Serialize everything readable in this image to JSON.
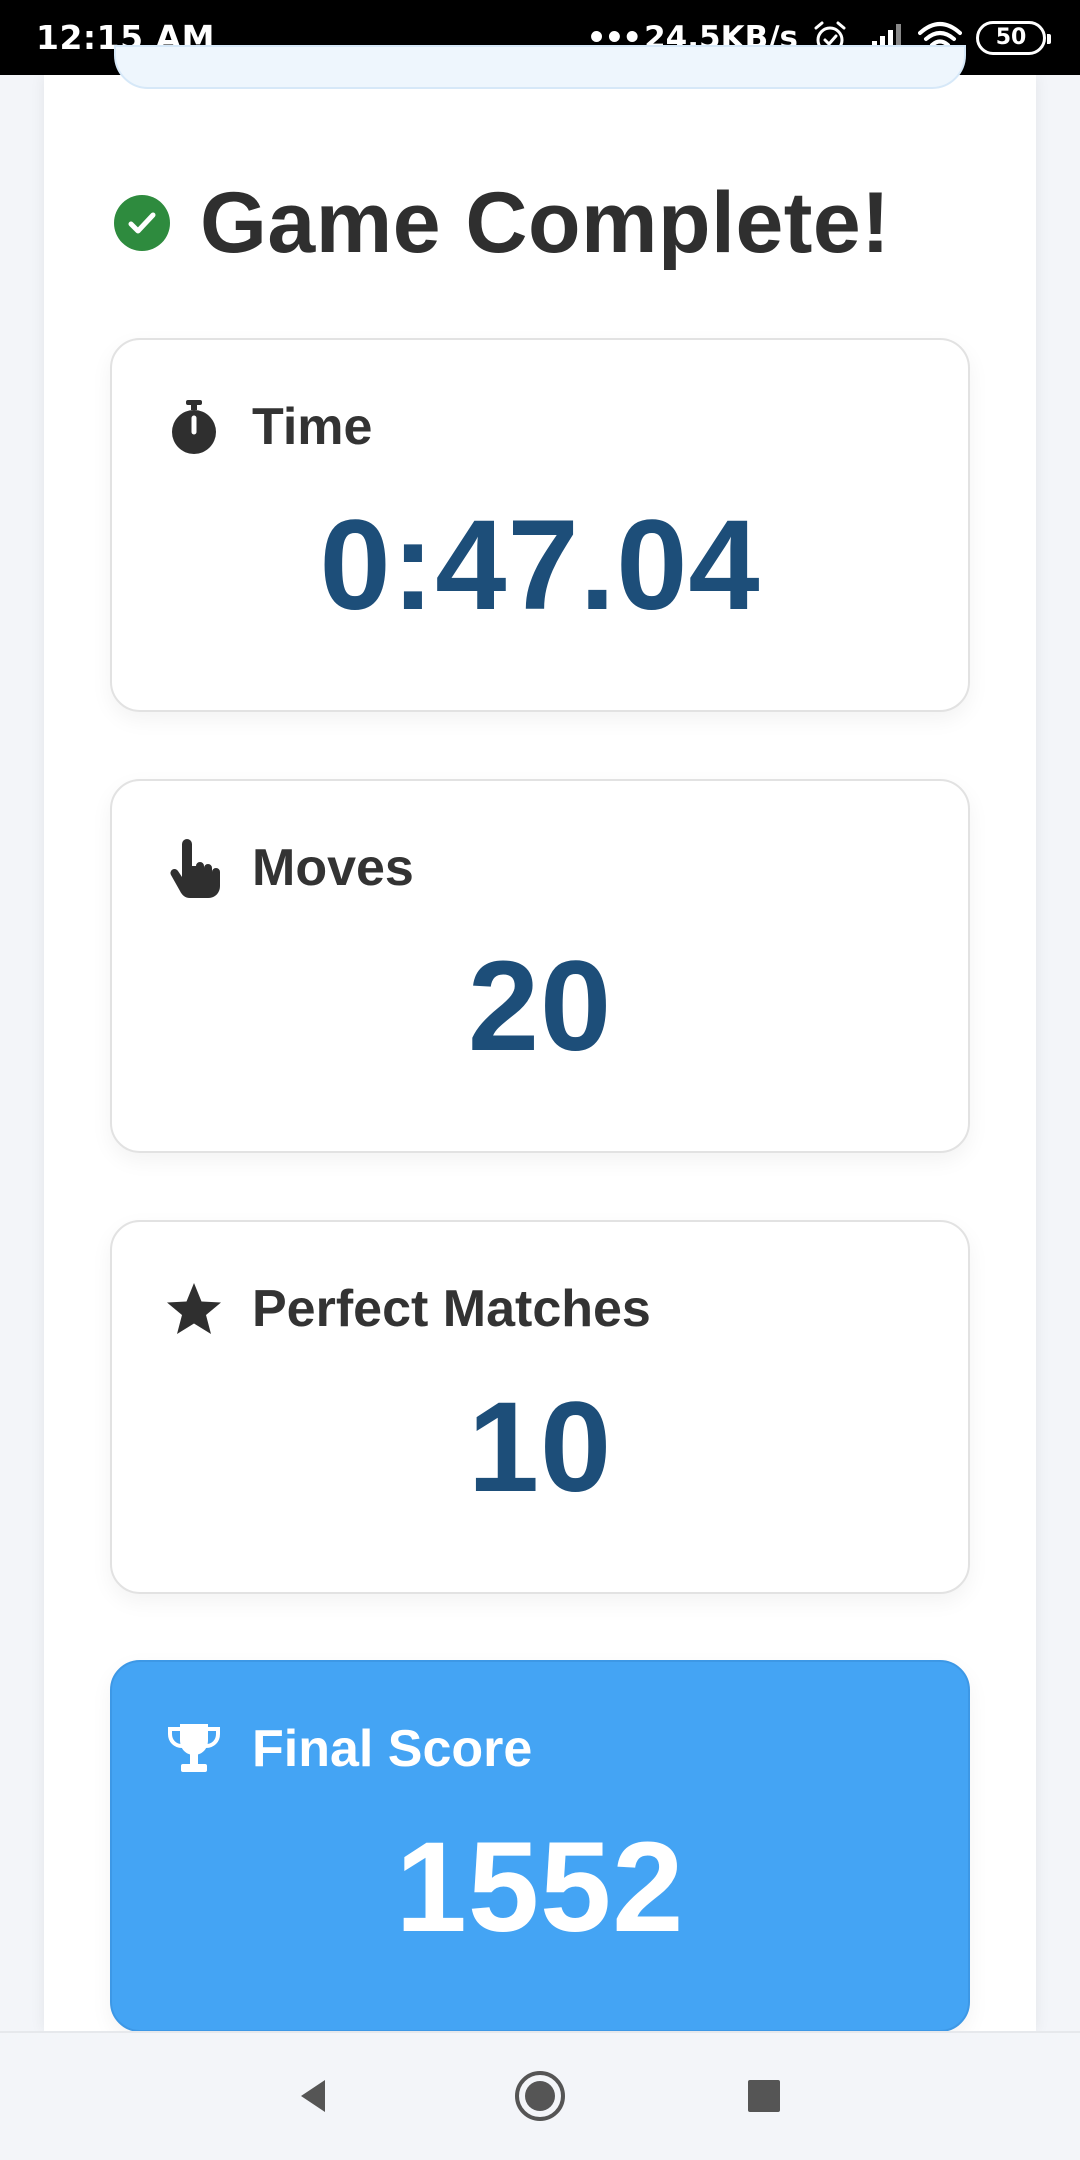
{
  "status_bar": {
    "time": "12:15 AM",
    "net_dots": "•••",
    "net_speed": "24.5KB/s",
    "battery_level": "50",
    "icons": [
      "alarm-icon",
      "signal-icon",
      "wifi-icon",
      "battery-icon"
    ]
  },
  "game": {
    "title": "Game Complete!",
    "title_icon": "check-circle-icon",
    "title_icon_color": "#2e8b3e"
  },
  "stats": {
    "time": {
      "label": "Time",
      "value": "0:47.04",
      "icon": "stopwatch-icon"
    },
    "moves": {
      "label": "Moves",
      "value": "20",
      "icon": "hand-pointer-icon"
    },
    "perfect": {
      "label": "Perfect Matches",
      "value": "10",
      "icon": "star-icon"
    },
    "score": {
      "label": "Final Score",
      "value": "1552",
      "icon": "trophy-icon"
    }
  },
  "colors": {
    "value_text": "#1d4e79",
    "score_card_bg": "#44a4f4",
    "page_bg": "#f3f5f9"
  },
  "nav_bar": {
    "buttons": [
      "back-icon",
      "home-icon",
      "recents-icon"
    ]
  }
}
